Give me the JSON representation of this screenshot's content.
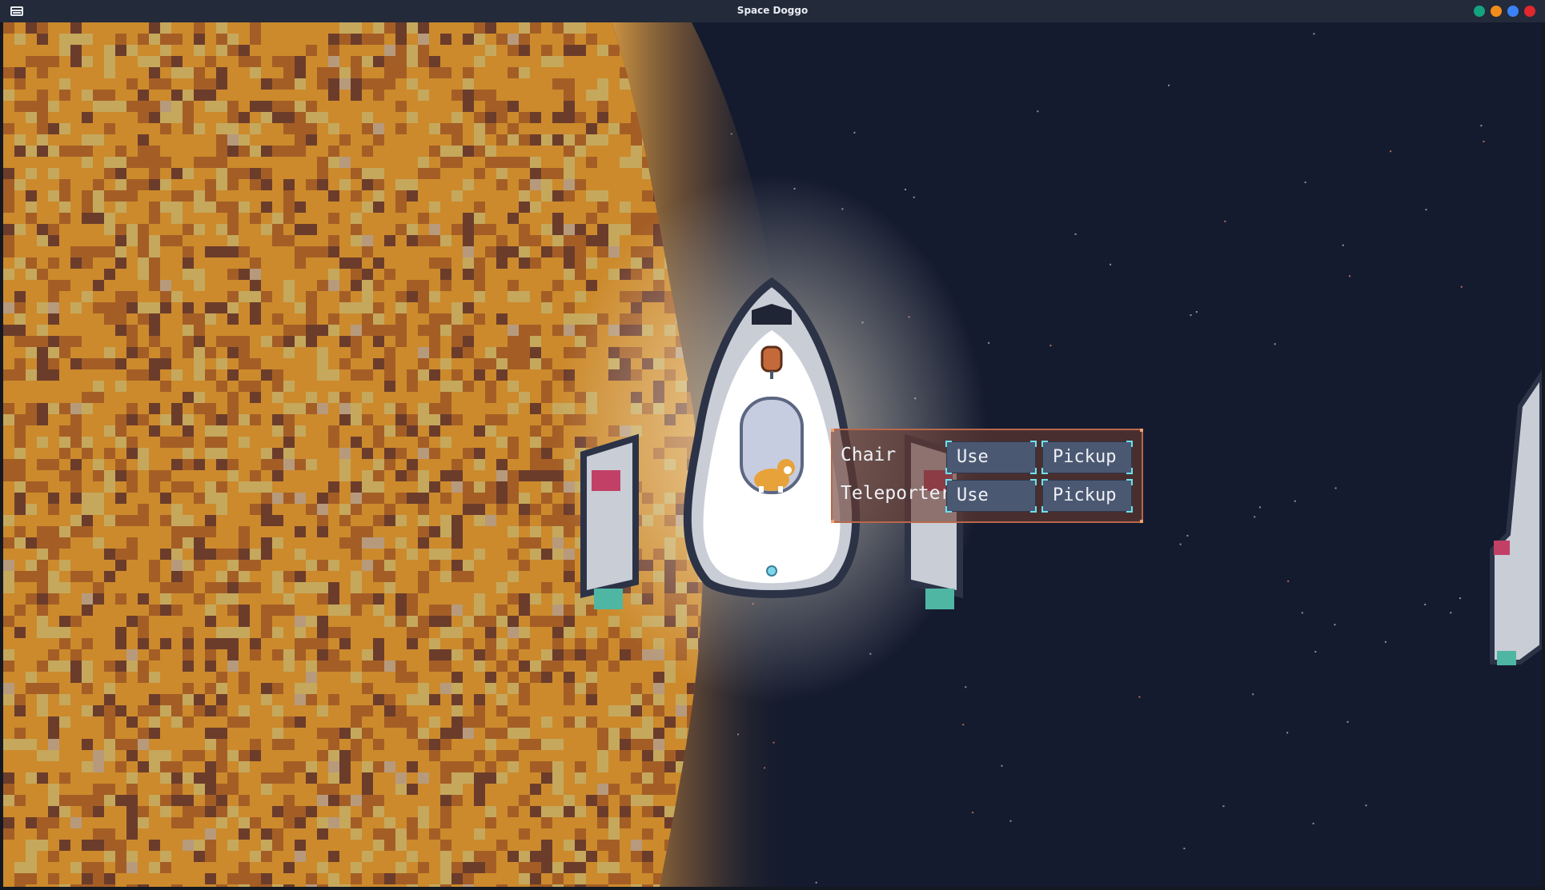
{
  "window": {
    "title": "Space Doggo",
    "buttons": [
      {
        "name": "window-button-green",
        "color": "#14a37f"
      },
      {
        "name": "window-button-orange",
        "color": "#f28c1b"
      },
      {
        "name": "window-button-blue",
        "color": "#3b82f6"
      },
      {
        "name": "window-button-red",
        "color": "#e0282e"
      }
    ]
  },
  "scene": {
    "space_color": "#151b2e",
    "planet_colors": [
      "#cc8a2c",
      "#a45e25",
      "#6c3c2b",
      "#c5a85c",
      "#b79a7c"
    ],
    "ship_colors": {
      "hull": "#c9cdd6",
      "outline": "#2c3346",
      "cabin": "#ffffff",
      "engine": "#4fb6a4",
      "light": "#c24066"
    }
  },
  "interaction_menu": {
    "rows": [
      {
        "label": "Chair",
        "use_label": "Use",
        "pickup_label": "Pickup"
      },
      {
        "label": "Teleporter",
        "use_label": "Use",
        "pickup_label": "Pickup"
      }
    ]
  }
}
